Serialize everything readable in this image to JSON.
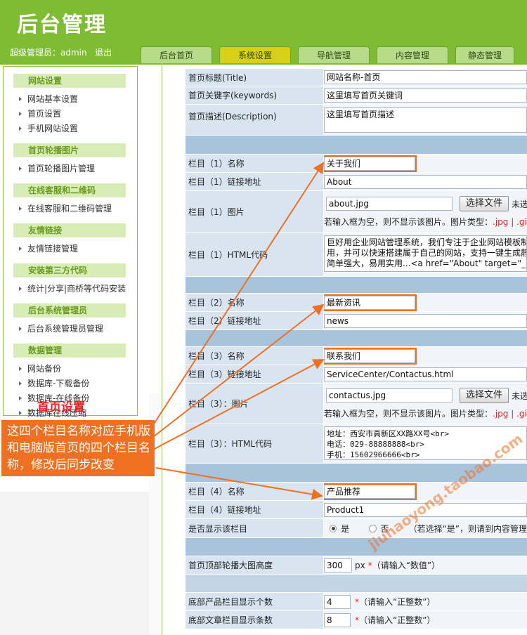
{
  "header": {
    "logo": "后台管理",
    "admin_text": "超级管理员：admin",
    "logout": "退出",
    "tabs": [
      "后台首页",
      "系统设置",
      "导航管理",
      "内容管理",
      "静态管理"
    ]
  },
  "sidebar": {
    "groups": [
      {
        "title": "网站设置",
        "items": [
          "网站基本设置",
          "首页设置",
          "手机网站设置"
        ]
      },
      {
        "title": "首页轮播图片",
        "items": [
          "首页轮播图片管理"
        ]
      },
      {
        "title": "在线客服和二维码",
        "items": [
          "在线客服和二维码管理"
        ]
      },
      {
        "title": "友情链接",
        "items": [
          "友情链接管理"
        ]
      },
      {
        "title": "安装第三方代码",
        "items": [
          "统计|分享|商桥等代码安装"
        ]
      },
      {
        "title": "后台系统管理员",
        "items": [
          "后台系统管理员管理"
        ]
      },
      {
        "title": "数据管理",
        "items": [
          "网站备份",
          "数据库-下载备份",
          "数据库-在线备份",
          "数据库在线压缩"
        ]
      }
    ],
    "note": "首页设置"
  },
  "form": {
    "title_label": "首页标题(Title)",
    "title_value": "网站名称-首页",
    "keywords_label": "首页关键字(keywords)",
    "keywords_value": "这里填写首页关键词",
    "desc_label": "首页描述(Description)",
    "desc_value": "这里填写首页描述",
    "col1_name_label": "栏目（1）名称",
    "col1_name_value": "关于我们",
    "col1_link_label": "栏目（1）链接地址",
    "col1_link_value": "About",
    "col1_img_label": "栏目（1）图片",
    "col1_img_value": "about.jpg",
    "choose_file": "选择文件",
    "no_file": "未选",
    "img_hint": "若输入框为空，则不显示该图片。图片类型：",
    "img_types": ".jpg | .gi",
    "col1_html_label": "栏目（1）HTML代码",
    "col1_html_value": "巨好用企业网站管理系统，我们专注于企业网站模板制\n用，并可以快速搭建属于自己的网站，支持一键生成静\n简单强大，易用实用...<a href=\"About\" target=\"_bl",
    "col2_name_label": "栏目（2）名称",
    "col2_name_value": "最新资讯",
    "col2_link_label": "栏目（2）链接地址",
    "col2_link_value": "news",
    "col3_name_label": "栏目（3）名称",
    "col3_name_value": "联系我们",
    "col3_link_label": "栏目（3）链接地址",
    "col3_link_value": "ServiceCenter/Contactus.html",
    "col3_img_label": "栏目（3）：图片",
    "col3_img_value": "contactus.jpg",
    "img_types3": ".jpg | .gi",
    "col3_html_label": "栏目（3）：HTML代码",
    "col3_html_value": "地址：西安市高新区XX路XX号<br>\n电话：029-88888888<br>\n手机：15602966666<br>",
    "col4_name_label": "栏目（4）名称",
    "col4_name_value": "产品推荐",
    "col4_link_label": "栏目（4）链接地址",
    "col4_link_value": "Product1",
    "show_label": "是否显示该栏目",
    "yes": "是",
    "no": "否",
    "show_hint": "（若选择“是”，则请到内容管理",
    "banner_label": "首页顶部轮播大图高度",
    "banner_value": "300",
    "banner_unit": "px",
    "star": "*",
    "banner_hint": "（请输入“数值”）",
    "prod_label": "底部产品栏目显示个数",
    "prod_value": "4",
    "article_label": "底部文章栏目显示条数",
    "article_value": "8",
    "int_hint": "（请输入“正整数”）"
  },
  "callout": "这四个栏目名称对应手机版和电脑版首页的四个栏目名称，修改后同步改变",
  "watermark": "jiuhaoyong.taobao.com",
  "colors": {
    "header": "#7ebc34",
    "accent": "#f07022",
    "label_bg": "#d8e5f1",
    "band": "#a8c4dc"
  }
}
